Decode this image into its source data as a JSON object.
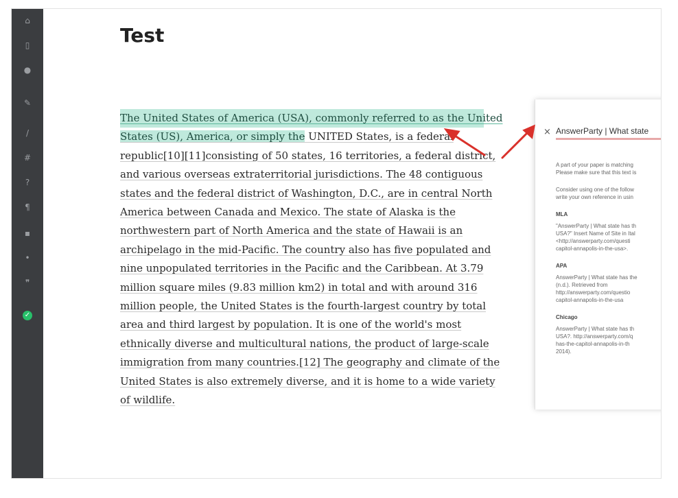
{
  "sidebar": {
    "icons": [
      {
        "name": "home-icon",
        "glyph": "⌂"
      },
      {
        "name": "document-icon",
        "glyph": "▯"
      },
      {
        "name": "microphone-icon",
        "glyph": "●"
      },
      {
        "name": "edit-icon",
        "glyph": "✎"
      },
      {
        "name": "brush-icon",
        "glyph": "/"
      },
      {
        "name": "link-icon",
        "glyph": "#"
      },
      {
        "name": "help-icon",
        "glyph": "?"
      },
      {
        "name": "paragraph-icon",
        "glyph": "¶"
      },
      {
        "name": "trash-icon",
        "glyph": "▪"
      },
      {
        "name": "settings-icon",
        "glyph": "•"
      },
      {
        "name": "quote-icon",
        "glyph": "❞"
      },
      {
        "name": "check-icon",
        "glyph": "✓"
      }
    ],
    "colors": {
      "background": "#3b3d40",
      "check": "#27c06a"
    }
  },
  "document": {
    "title": "Test",
    "line1": "The United States of America (USA), commonly referred to as the United",
    "line2_highlight": "States (US), America, or simply the",
    "line2_rest": " UNITED States, is a federal",
    "lines": [
      "republic[10][11]consisting of 50 states, 16 territories, a federal district,",
      "and various overseas extraterritorial jurisdictions. The 48 contiguous",
      "states and the federal district of Washington, D.C., are in central North",
      "America between Canada and Mexico. The state of Alaska is the",
      "northwestern part of North America and the state of Hawaii is an",
      "archipelago in the mid-Pacific. The country also has five populated and",
      "nine unpopulated territories in the Pacific and the Caribbean. At 3.79",
      "million square miles (9.83 million km2) in total and with around 316",
      "million people, the United States is the fourth-largest country by total",
      "area and third largest by population. It is one of the world's most",
      "ethnically diverse and multicultural nations, the product of large-scale",
      "immigration from many countries.[12] The geography and climate of the",
      "United States is also extremely diverse, and it is home to a wide variety",
      "of wildlife."
    ],
    "highlight_color": "#bfe9dc"
  },
  "panel": {
    "close_glyph": "×",
    "title": "AnswerParty | What state",
    "intro1": "A part of your paper is matching",
    "intro2": "Please make sure that this text is",
    "consider1": "Consider using one of the follow",
    "consider2": "write your own reference in usin",
    "mla_heading": "MLA",
    "mla1": "\"AnswerParty | What state has th",
    "mla2": "USA?\" Insert Name of Site in Ital",
    "mla3": "<http://answerparty.com/questi",
    "mla4": "capitol-annapolis-in-the-usa>.",
    "apa_heading": "APA",
    "apa1": "AnswerParty | What state has the",
    "apa2": "(n.d.). Retrieved from",
    "apa3": "http://answerparty.com/questio",
    "apa4": "capitol-annapolis-in-the-usa",
    "chicago_heading": "Chicago",
    "chicago1": "AnswerParty | What state has th",
    "chicago2": "USA?. http://answerparty.com/q",
    "chicago3": "has-the-capitol-annapolis-in-th",
    "chicago4": "2014)."
  },
  "annotation": {
    "arrow_color": "#d9312b"
  }
}
